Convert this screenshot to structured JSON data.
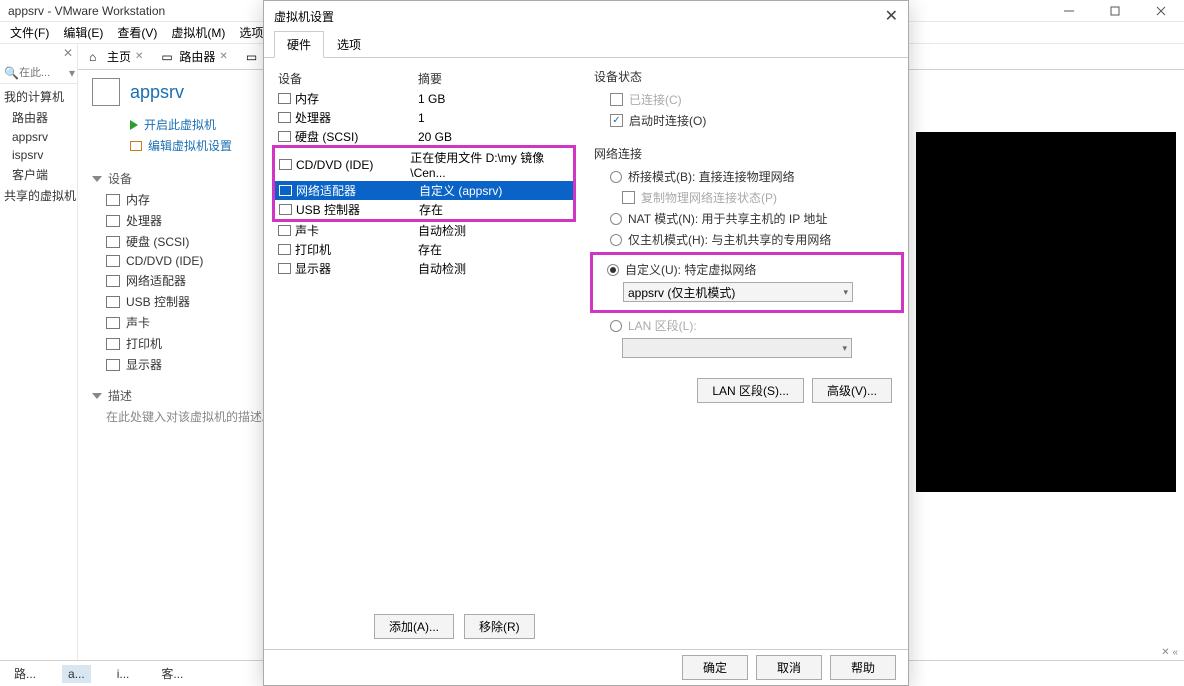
{
  "titlebar": "appsrv - VMware Workstation",
  "menus": {
    "file": "文件(F)",
    "edit": "编辑(E)",
    "view": "查看(V)",
    "vm": "虚拟机(M)",
    "tabs": "选项卡(T)"
  },
  "sidebar": {
    "searchPlaceholder": "在此...",
    "root": "我的计算机",
    "items": [
      "路由器",
      "appsrv",
      "ispsrv",
      "客户端"
    ],
    "shared": "共享的虚拟机"
  },
  "tabs": {
    "home": "主页",
    "router": "路由器"
  },
  "vm": {
    "name": "appsrv",
    "powerOn": "开启此虚拟机",
    "editSettings": "编辑虚拟机设置"
  },
  "sections": {
    "devices": "设备",
    "desc": "描述"
  },
  "devlist": [
    "内存",
    "处理器",
    "硬盘 (SCSI)",
    "CD/DVD (IDE)",
    "网络适配器",
    "USB 控制器",
    "声卡",
    "打印机",
    "显示器"
  ],
  "descText": "在此处键入对该虚拟机的描述。",
  "dialog": {
    "title": "虚拟机设置",
    "tabHw": "硬件",
    "tabOpt": "选项",
    "colDev": "设备",
    "colSum": "摘要",
    "rows": [
      {
        "n": "内存",
        "s": "1 GB"
      },
      {
        "n": "处理器",
        "s": "1"
      },
      {
        "n": "硬盘 (SCSI)",
        "s": "20 GB"
      },
      {
        "n": "CD/DVD (IDE)",
        "s": "正在使用文件 D:\\my 镜像\\Cen..."
      },
      {
        "n": "网络适配器",
        "s": "自定义 (appsrv)"
      },
      {
        "n": "USB 控制器",
        "s": "存在"
      },
      {
        "n": "声卡",
        "s": "自动检测"
      },
      {
        "n": "打印机",
        "s": "存在"
      },
      {
        "n": "显示器",
        "s": "自动检测"
      }
    ],
    "addBtn": "添加(A)...",
    "removeBtn": "移除(R)",
    "state": {
      "title": "设备状态",
      "connected": "已连接(C)",
      "onPower": "启动时连接(O)"
    },
    "net": {
      "title": "网络连接",
      "bridged": "桥接模式(B): 直接连接物理网络",
      "replicate": "复制物理网络连接状态(P)",
      "nat": "NAT 模式(N): 用于共享主机的 IP 地址",
      "hostonly": "仅主机模式(H): 与主机共享的专用网络",
      "custom": "自定义(U): 特定虚拟网络",
      "customSel": "appsrv (仅主机模式)",
      "lan": "LAN 区段(L):",
      "lanBtn": "LAN 区段(S)...",
      "advBtn": "高级(V)..."
    },
    "ok": "确定",
    "cancel": "取消",
    "help": "帮助"
  },
  "thumbs": [
    "路...",
    "a...",
    "i...",
    "客..."
  ]
}
